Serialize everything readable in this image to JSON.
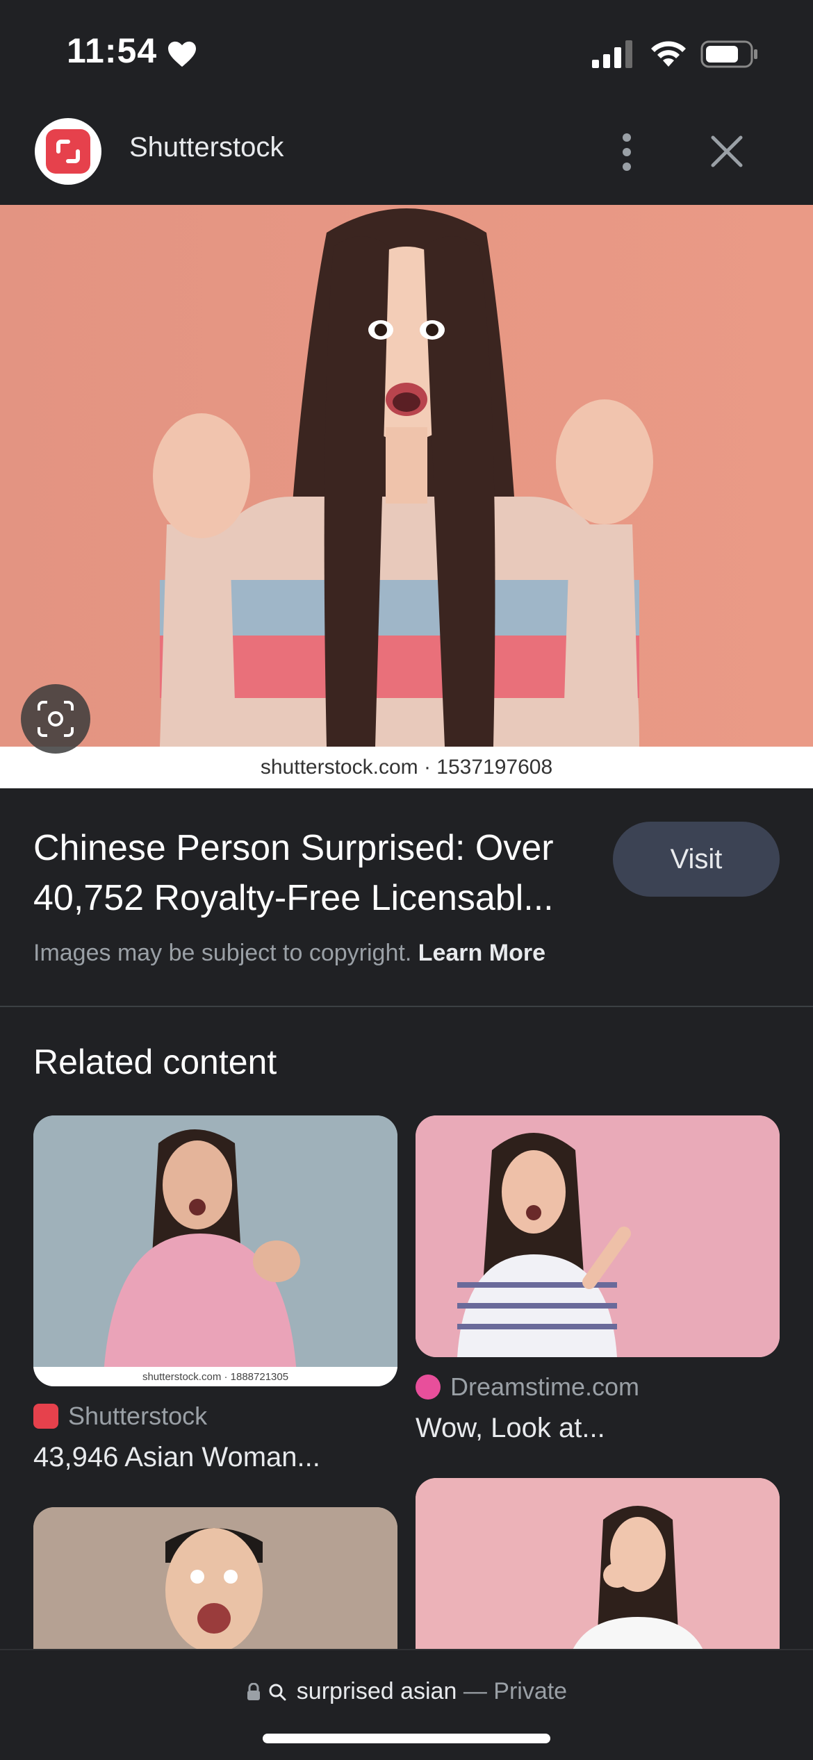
{
  "status": {
    "time": "11:54"
  },
  "header": {
    "site_name": "Shutterstock"
  },
  "main_image": {
    "watermark": "shutterstock.com · 1537197608"
  },
  "info": {
    "title": "Chinese Person Surprised: Over 40,752 Royalty-Free Licensabl...",
    "visit_label": "Visit",
    "copyright_text": "Images may be subject to copyright.",
    "learn_more": "Learn More"
  },
  "related": {
    "heading": "Related content",
    "cards": [
      {
        "source": "Shutterstock",
        "caption": "43,946 Asian Woman...",
        "watermark": "shutterstock.com · 1888721305"
      },
      {
        "source": "Dreamstime.com",
        "caption": "Wow, Look at..."
      },
      {
        "source": "",
        "caption": ""
      },
      {
        "source": "",
        "caption": ""
      }
    ]
  },
  "bottom": {
    "query": "surprised asian",
    "separator": "—",
    "mode": "Private"
  },
  "colors": {
    "background": "#202124",
    "visit_button": "#3c4354",
    "shutterstock_red": "#e6414c",
    "image_bg": "#e39482"
  }
}
